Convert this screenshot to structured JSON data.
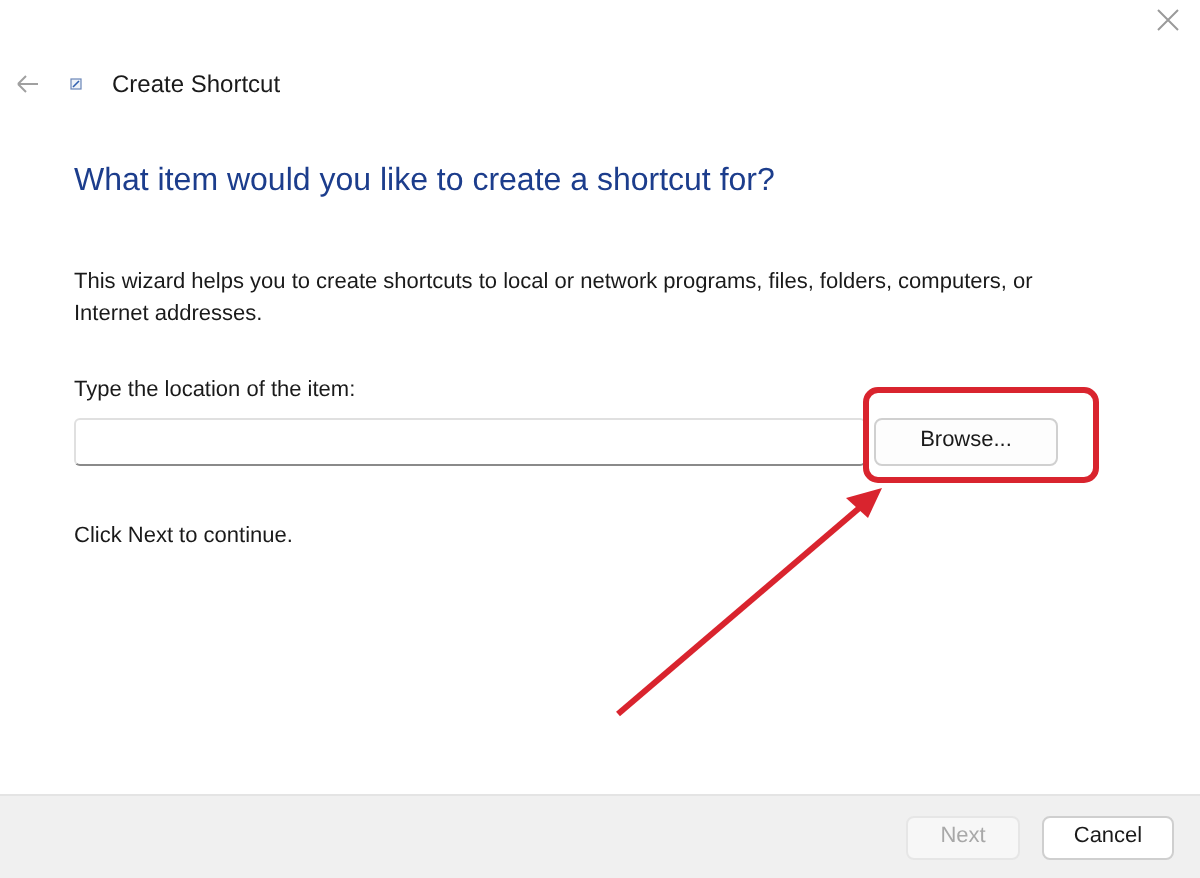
{
  "window": {
    "title": "Create Shortcut"
  },
  "heading": "What item would you like to create a shortcut for?",
  "description": "This wizard helps you to create shortcuts to local or network programs, files, folders, computers, or Internet addresses.",
  "location": {
    "label": "Type the location of the item:"
  },
  "browse_button": "Browse...",
  "hint": "Click Next to continue.",
  "buttons": [
    {
      "label": "Next",
      "disabled": true
    },
    {
      "label": "Cancel",
      "disabled": false
    }
  ]
}
